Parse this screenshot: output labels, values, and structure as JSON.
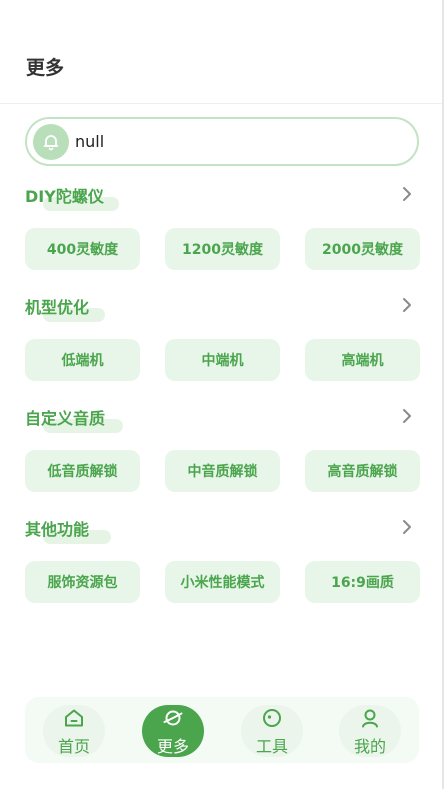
{
  "header": {
    "title": "更多"
  },
  "notice": {
    "text": "null"
  },
  "sections": [
    {
      "title": "DIY陀螺仪",
      "buttons": [
        "400灵敏度",
        "1200灵敏度",
        "2000灵敏度"
      ]
    },
    {
      "title": "机型优化",
      "buttons": [
        "低端机",
        "中端机",
        "高端机"
      ]
    },
    {
      "title": "自定义音质",
      "buttons": [
        "低音质解锁",
        "中音质解锁",
        "高音质解锁"
      ]
    },
    {
      "title": "其他功能",
      "buttons": [
        "服饰资源包",
        "小米性能模式",
        "16:9画质"
      ]
    }
  ],
  "tabbar": {
    "items": [
      {
        "label": "首页",
        "icon": "home-icon"
      },
      {
        "label": "更多",
        "icon": "planet-icon",
        "active": true
      },
      {
        "label": "工具",
        "icon": "tool-icon"
      },
      {
        "label": "我的",
        "icon": "user-icon"
      }
    ]
  },
  "colors": {
    "accent": "#4aa54d",
    "button_bg": "#e8f5e9",
    "bell_bg": "#b9dfba"
  }
}
